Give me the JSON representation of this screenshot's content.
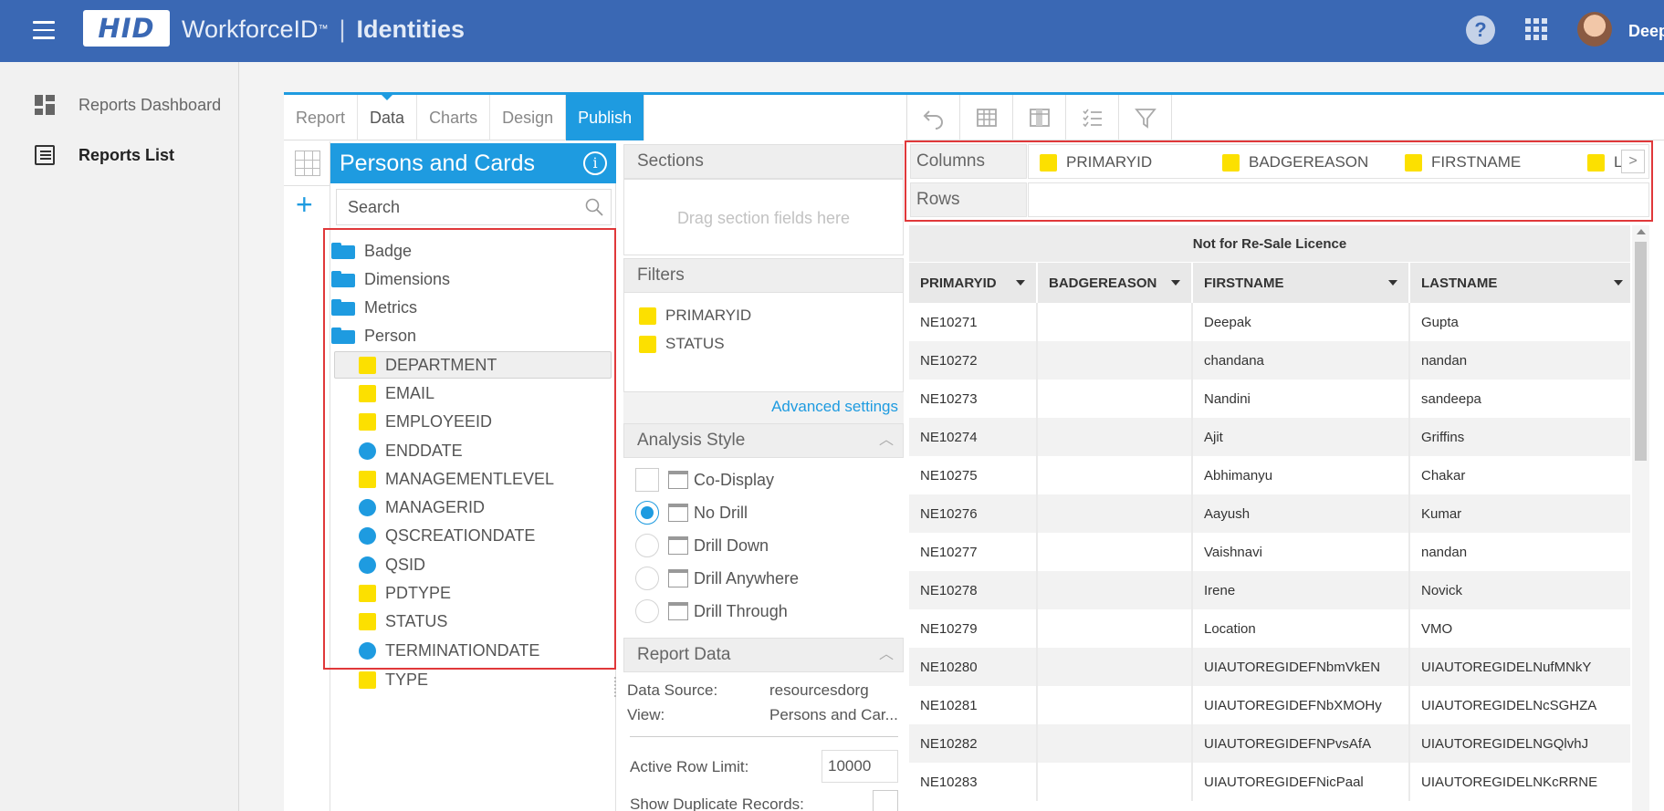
{
  "header": {
    "logo_text": "HID",
    "brand": "WorkforceID",
    "trademark": "™",
    "separator": "|",
    "module": "Identities",
    "help_glyph": "?",
    "user_name": "Deep",
    "bg_color": "#3a68b4"
  },
  "nav": {
    "items": [
      {
        "label": "Reports Dashboard",
        "icon": "dashboard-icon"
      },
      {
        "label": "Reports List",
        "icon": "reports-list-icon",
        "active": true
      }
    ]
  },
  "tabs": [
    "Report",
    "Data",
    "Charts",
    "Design",
    "Publish"
  ],
  "active_tab": "Publish",
  "accent_color": "#1e9be0",
  "panel": {
    "title": "Persons and Cards",
    "search_placeholder": "Search",
    "folders": [
      "Badge",
      "Dimensions",
      "Metrics",
      "Person"
    ],
    "fields": [
      {
        "name": "DEPARTMENT",
        "kind": "dimension"
      },
      {
        "name": "EMAIL",
        "kind": "dimension"
      },
      {
        "name": "EMPLOYEEID",
        "kind": "dimension"
      },
      {
        "name": "ENDDATE",
        "kind": "date"
      },
      {
        "name": "MANAGEMENTLEVEL",
        "kind": "dimension"
      },
      {
        "name": "MANAGERID",
        "kind": "date"
      },
      {
        "name": "QSCREATIONDATE",
        "kind": "date"
      },
      {
        "name": "QSID",
        "kind": "date"
      },
      {
        "name": "PDTYPE",
        "kind": "dimension"
      },
      {
        "name": "STATUS",
        "kind": "dimension"
      },
      {
        "name": "TERMINATIONDATE",
        "kind": "date"
      },
      {
        "name": "TYPE",
        "kind": "dimension"
      }
    ]
  },
  "sections": {
    "title": "Sections",
    "hint": "Drag section fields here"
  },
  "filters": {
    "title": "Filters",
    "items": [
      "PRIMARYID",
      "STATUS"
    ],
    "advanced_link": "Advanced settings"
  },
  "analysis_style": {
    "title": "Analysis Style",
    "co_display": "Co-Display",
    "options": [
      "No Drill",
      "Drill Down",
      "Drill Anywhere",
      "Drill Through"
    ],
    "selected": "No Drill"
  },
  "report_data": {
    "title": "Report Data",
    "data_source_label": "Data Source:",
    "data_source_value": "resourcesdorg",
    "view_label": "View:",
    "view_value": "Persons and Car...",
    "row_limit_label": "Active Row Limit:",
    "row_limit_value": "10000",
    "duplicates_label": "Show Duplicate Records:"
  },
  "layout_fields": {
    "columns_label": "Columns",
    "rows_label": "Rows",
    "columns": [
      "PRIMARYID",
      "BADGEREASON",
      "FIRSTNAME",
      "L"
    ]
  },
  "table": {
    "licence": "Not for Re-Sale Licence",
    "headers": [
      "PRIMARYID",
      "BADGEREASON",
      "FIRSTNAME",
      "LASTNAME"
    ],
    "rows": [
      [
        "NE10271",
        "",
        "Deepak",
        "Gupta"
      ],
      [
        "NE10272",
        "",
        "chandana",
        "nandan"
      ],
      [
        "NE10273",
        "",
        "Nandini",
        "sandeepa"
      ],
      [
        "NE10274",
        "",
        "Ajit",
        "Griffins"
      ],
      [
        "NE10275",
        "",
        "Abhimanyu",
        "Chakar"
      ],
      [
        "NE10276",
        "",
        "Aayush",
        "Kumar"
      ],
      [
        "NE10277",
        "",
        "Vaishnavi",
        "nandan"
      ],
      [
        "NE10278",
        "",
        "Irene",
        "Novick"
      ],
      [
        "NE10279",
        "",
        "Location",
        "VMO"
      ],
      [
        "NE10280",
        "",
        "UIAUTOREGIDEFNbmVkEN",
        "UIAUTOREGIDELNufMNkY"
      ],
      [
        "NE10281",
        "",
        "UIAUTOREGIDEFNbXMOHy",
        "UIAUTOREGIDELNcSGHZA"
      ],
      [
        "NE10282",
        "",
        "UIAUTOREGIDEFNPvsAfA",
        "UIAUTOREGIDELNGQlvhJ"
      ],
      [
        "NE10283",
        "",
        "UIAUTOREGIDEFNicPaal",
        "UIAUTOREGIDELNKcRRNE"
      ]
    ]
  }
}
